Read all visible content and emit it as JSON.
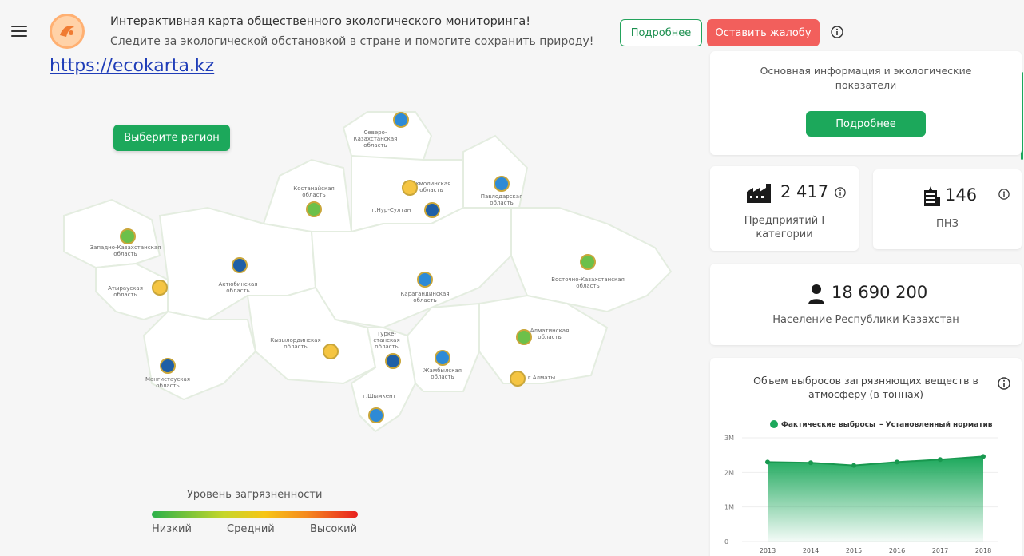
{
  "header": {
    "title": "Интерактивная карта общественного экологического мониторинга!",
    "subtitle": "Следите за экологической обстановкой в стране и помогите сохранить природу!",
    "more_label": "Подробнее",
    "complaint_label": "Оставить жалобу"
  },
  "site_url": "https://ecokarta.kz",
  "map": {
    "select_region_label": "Выберите регион",
    "regions": [
      {
        "name": "Северо-Казахстанская область",
        "lines": [
          "Северо-",
          "Казахстанская",
          "область"
        ]
      },
      {
        "name": "Костанайская область",
        "lines": [
          "Костанайская",
          "область"
        ]
      },
      {
        "name": "Акмолинская область",
        "lines": [
          "Акмолинская",
          "область"
        ]
      },
      {
        "name": "г.Нур-Султан",
        "lines": [
          "г.Нур-Султан"
        ]
      },
      {
        "name": "Павлодарская область",
        "lines": [
          "Павлодарская",
          "область"
        ]
      },
      {
        "name": "Западно-Казахстанская область",
        "lines": [
          "Западно-Казахстанская",
          "область"
        ]
      },
      {
        "name": "Атырауская область",
        "lines": [
          "Атырауская",
          "область"
        ]
      },
      {
        "name": "Актюбинская область",
        "lines": [
          "Актюбинская",
          "область"
        ]
      },
      {
        "name": "Карагандинская область",
        "lines": [
          "Карагандинская",
          "область"
        ]
      },
      {
        "name": "Восточно-Казахстанская область",
        "lines": [
          "Восточно-Казахстанская",
          "область"
        ]
      },
      {
        "name": "Кызылординская область",
        "lines": [
          "Кызылординская",
          "область"
        ]
      },
      {
        "name": "Туркестанская область",
        "lines": [
          "Турке-",
          "станская",
          "область"
        ]
      },
      {
        "name": "Жамбылская область",
        "lines": [
          "Жамбылская",
          "область"
        ]
      },
      {
        "name": "Алматинская область",
        "lines": [
          "Алматинская",
          "область"
        ]
      },
      {
        "name": "г.Алматы",
        "lines": [
          "г.Алматы"
        ]
      },
      {
        "name": "Мангистауская область",
        "lines": [
          "Мангистауская",
          "область"
        ]
      },
      {
        "name": "г.Шымкент",
        "lines": [
          "г.Шымкент"
        ]
      }
    ]
  },
  "legend": {
    "title": "Уровень загрязненности",
    "low": "Низкий",
    "mid": "Средний",
    "high": "Высокий"
  },
  "info_card": {
    "text": "Основная информация и экологические показатели",
    "button": "Подробнее"
  },
  "stats": {
    "enterprises_value": "2 417",
    "enterprises_label": "Предприятий I категории",
    "pnz_value": "146",
    "pnz_label": "ПНЗ",
    "population_value": "18 690 200",
    "population_label": "Население Республики Казахстан"
  },
  "chart_data": {
    "type": "area",
    "title": "Объем выбросов загрязняющих веществ в атмосферу (в тоннах)",
    "legend": [
      "Фактические выбросы",
      "Установленный норматив"
    ],
    "categories": [
      "2013",
      "2014",
      "2015",
      "2016",
      "2017",
      "2018"
    ],
    "y_ticks": [
      "3M",
      "2M",
      "1M",
      "0"
    ],
    "series": [
      {
        "name": "Фактические выбросы",
        "values": [
          2.3,
          2.28,
          2.2,
          2.3,
          2.37,
          2.46
        ]
      }
    ],
    "ylim": [
      0,
      3
    ],
    "color": "#1ca85b"
  }
}
